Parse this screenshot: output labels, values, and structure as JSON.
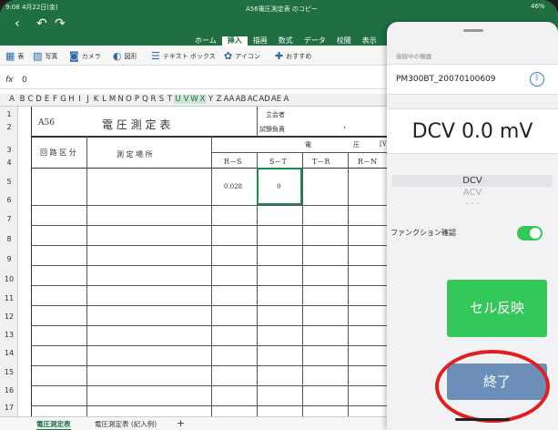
{
  "status": {
    "time_date": "9:08 4月22日(金)",
    "battery": "46%",
    "doc_title": "A56電圧測定表 のコピー"
  },
  "toolbar_icons": {
    "back": "chevron-left-icon",
    "undo": "undo-icon",
    "redo": "redo-icon"
  },
  "ribbon_tabs": [
    {
      "label": "ホーム",
      "active": false
    },
    {
      "label": "挿入",
      "active": true
    },
    {
      "label": "描画",
      "active": false
    },
    {
      "label": "数式",
      "active": false
    },
    {
      "label": "データ",
      "active": false
    },
    {
      "label": "校閲",
      "active": false
    },
    {
      "label": "表示",
      "active": false
    }
  ],
  "insert_tools": [
    {
      "label": "表",
      "icon": "table-icon"
    },
    {
      "label": "写真",
      "icon": "photo-icon"
    },
    {
      "label": "カメラ",
      "icon": "camera-icon"
    },
    {
      "label": "図形",
      "icon": "shapes-icon"
    },
    {
      "label": "テキスト ボックス",
      "icon": "textbox-icon"
    },
    {
      "label": "アイコン",
      "icon": "icons-icon"
    },
    {
      "label": "おすすめ",
      "icon": "recommended-icon"
    }
  ],
  "formula_bar": {
    "fx": "fx",
    "value": "0"
  },
  "columns": [
    "A",
    "B",
    "C",
    "D",
    "E",
    "F",
    "G",
    "H",
    "I",
    "J",
    "K",
    "L",
    "M",
    "N",
    "O",
    "P",
    "Q",
    "R",
    "S",
    "T",
    "U",
    "V",
    "W",
    "X",
    "Y",
    "Z",
    "AA",
    "AB",
    "AC",
    "AD",
    "AE",
    "A"
  ],
  "rows": [
    "1",
    "2",
    "3",
    "4",
    "5",
    "6",
    "7",
    "8",
    "9",
    "10",
    "11",
    "12",
    "13",
    "14",
    "15",
    "16",
    "17"
  ],
  "sheet": {
    "code": "A56",
    "title": "電 圧 測 定 表",
    "signer_top": "立会者",
    "signer_bottom": "試験負責",
    "dot": "・",
    "col_circuit": "回 路 区 分",
    "col_place": "測 定 場 所",
    "voltage_hdr_a": "電",
    "voltage_hdr_b": "圧",
    "voltage_unit": "[V]",
    "rs": "R－S",
    "st": "S－T",
    "tr": "T－R",
    "rn": "R－N",
    "val_rs": "0.028",
    "val_st": "0"
  },
  "sheet_tabs": [
    {
      "label": "電圧測定表",
      "active": true
    },
    {
      "label": "電圧測定表 (記入例)",
      "active": false
    }
  ],
  "add_sheet": "+",
  "panel": {
    "connected_label": "接続中の機器",
    "device": "PM300BT_20070100609",
    "reading": "DCV 0.0 mV",
    "functions": [
      "DCV",
      "ACV",
      "・・・"
    ],
    "selected_function": "DCV",
    "function_confirm_label": "ファンクション確認",
    "function_confirm_on": true,
    "reflect_button": "セル反映",
    "finish_button": "終了"
  },
  "colors": {
    "excel_green": "#1f6f43",
    "ios_green": "#34c759",
    "finish_blue": "#6b8fb8",
    "annotation_red": "#e02020"
  }
}
